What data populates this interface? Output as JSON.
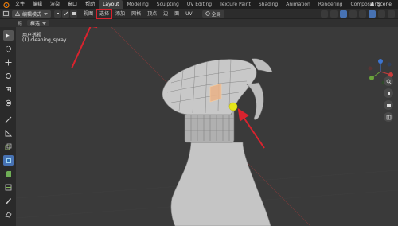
{
  "topbar": {
    "menus": [
      "文件",
      "编辑",
      "渲染",
      "窗口",
      "帮助"
    ],
    "workspaces": [
      "Layout",
      "Modeling",
      "Sculpting",
      "UV Editing",
      "Texture Paint",
      "Shading",
      "Animation",
      "Rendering",
      "Compositing"
    ],
    "active_workspace": "Layout",
    "scene_label": "Scene"
  },
  "header": {
    "mode": "编辑模式",
    "menus": [
      "视图",
      "选择",
      "添加",
      "网格",
      "顶点",
      "边",
      "面",
      "UV"
    ],
    "highlighted_menu": "选择",
    "pivot": "全局"
  },
  "toolrow": {
    "label": "拖",
    "select_mode": "框选"
  },
  "viewport": {
    "view_name": "用户透视",
    "object_name": "(1) cleaning_spray"
  },
  "colors": {
    "accent": "#4772b3",
    "annotation_red": "#d9232e",
    "active_tab": "#3d3d3d",
    "highlight_dot": "#e6e619"
  },
  "icons": {
    "logo": "blender-logo-icon",
    "toolbar": [
      "select-box-icon",
      "cursor-icon",
      "move-icon",
      "rotate-icon",
      "scale-icon",
      "transform-icon",
      "annotate-icon",
      "measure-icon",
      "extrude-icon",
      "inset-icon",
      "bevel-icon",
      "loop-cut-icon",
      "knife-icon",
      "poly-build-icon"
    ]
  }
}
